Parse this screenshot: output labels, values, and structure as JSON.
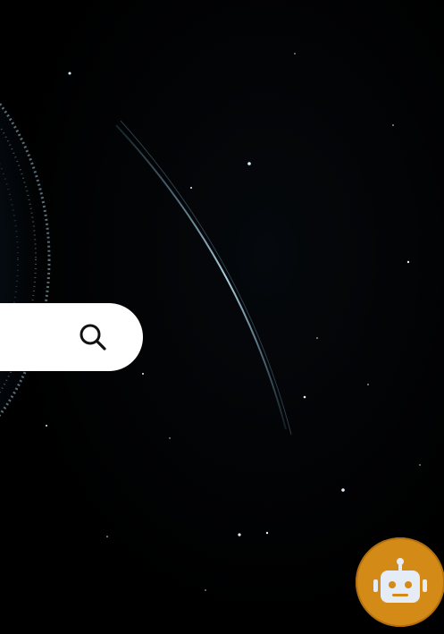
{
  "search": {
    "placeholder": "",
    "value": "",
    "icon": "search-icon"
  },
  "assistant": {
    "icon": "robot-icon",
    "color": "#d48a16"
  },
  "background": {
    "theme": "space"
  }
}
